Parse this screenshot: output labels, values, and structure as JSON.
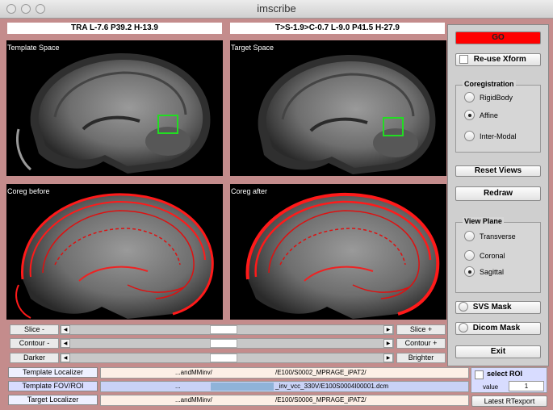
{
  "window": {
    "title": "imscribe"
  },
  "headers": {
    "template": "TRA L-7.6 P39.2 H-13.9",
    "target": "T>S-1.9>C-0.7 L-9.0 P41.5 H-27.9"
  },
  "panels": {
    "template_space": "Template Space",
    "target_space": "Target Space",
    "coreg_before": "Coreg before",
    "coreg_after": "Coreg after"
  },
  "sidebar": {
    "go_label": "GO",
    "go_color": "#ff0000",
    "reuse_xform": "Re-use Xform",
    "coregistration": {
      "title": "Coregistration",
      "options": [
        "RigidBody",
        "Affine",
        "Inter-Modal"
      ],
      "selected": "Affine"
    },
    "reset_views": "Reset Views",
    "redraw": "Redraw",
    "view_plane": {
      "title": "View Plane",
      "options": [
        "Transverse",
        "Coronal",
        "Sagittal"
      ],
      "selected": "Sagittal"
    },
    "svs_mask": "SVS Mask",
    "dicom_mask": "Dicom Mask",
    "exit": "Exit"
  },
  "sliders": {
    "slice": {
      "minus": "Slice -",
      "plus": "Slice +",
      "level": 0.49
    },
    "contour": {
      "minus": "Contour -",
      "plus": "Contour +",
      "level": 0.49
    },
    "bright": {
      "minus": "Darker",
      "plus": "Brighter",
      "level": 0.49
    }
  },
  "bottom": {
    "template_localizer": "Template Localizer",
    "template_fov": "Template FOV/ROI",
    "target_localizer": "Target Localizer",
    "path1_left": "...andMMinv/",
    "path1_right": "/E100/S0002_MPRAGE_iPAT2/",
    "path2_left": "...",
    "path2_right": "_inv_vcc_330V/E100S0004I00001.dcm",
    "path3_left": "...andMMinv/",
    "path3_right": "/E100/S0006_MPRAGE_iPAT2/",
    "select_roi": "select ROI",
    "value_label": "value",
    "value": "1",
    "latest_rtexport": "Latest RTexport"
  }
}
